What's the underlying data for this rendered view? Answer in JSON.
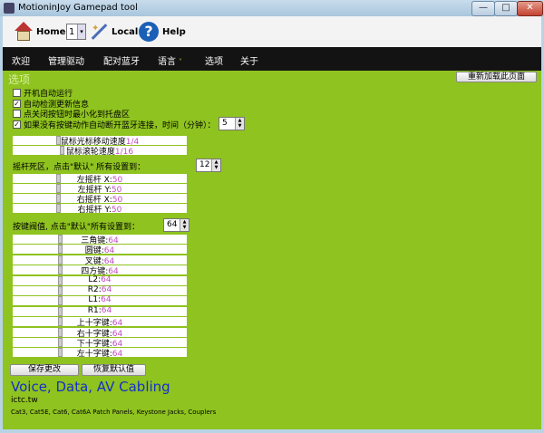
{
  "window": {
    "title": "MotioninJoy Gamepad tool",
    "min": "—",
    "max": "□",
    "close": "✕"
  },
  "toolbar": {
    "home": "Home",
    "selected": "1",
    "local": "Local",
    "help": "Help",
    "help_glyph": "?"
  },
  "menu": [
    "欢迎",
    "管理驱动",
    "配对蓝牙",
    "语言",
    "选项",
    "关于"
  ],
  "menu_chevron": "˅",
  "page": {
    "title": "选项",
    "reload": "重新加载此页面"
  },
  "options": [
    {
      "label": "开机自动运行",
      "checked": false
    },
    {
      "label": "自动检测更新信息",
      "checked": true
    },
    {
      "label": "点关闭按钮时最小化到托盘区",
      "checked": false
    },
    {
      "label": "如果没有按键动作自动断开蓝牙连接，时间（分钟）：",
      "checked": true
    }
  ],
  "timeout": "5",
  "mouse_sliders": [
    {
      "label": "鼠标光标移动速度",
      "value": "1/4",
      "level": 0.25
    },
    {
      "label": "鼠标滚轮速度",
      "value": "1/16",
      "level": 0.27
    }
  ],
  "deadzone": {
    "label": "摇杆死区，点击\"默认\" 所有设置到：",
    "value": "12",
    "sliders": [
      {
        "label": "左摇杆 X:",
        "value": "50"
      },
      {
        "label": "左摇杆 Y:",
        "value": "50"
      },
      {
        "label": "右摇杆 X:",
        "value": "50"
      },
      {
        "label": "右摇杆 Y:",
        "value": "50"
      }
    ]
  },
  "threshold": {
    "label": "按键阀值, 点击\"默认\"所有设置到：",
    "value": "64",
    "sliders": [
      {
        "label": "三角键:",
        "value": "64"
      },
      {
        "label": "圆键:",
        "value": "64"
      },
      {
        "label": "叉键:",
        "value": "64"
      },
      {
        "label": "四方键:",
        "value": "64"
      },
      {
        "label": "L2:",
        "value": "64"
      },
      {
        "label": "R2:",
        "value": "64"
      },
      {
        "label": "L1:",
        "value": "64"
      },
      {
        "label": "R1:",
        "value": "64"
      },
      {
        "label": "上十字键:",
        "value": "64"
      },
      {
        "label": "右十字键:",
        "value": "64"
      },
      {
        "label": "下十字键:",
        "value": "64"
      },
      {
        "label": "左十字键:",
        "value": "64"
      }
    ]
  },
  "buttons": {
    "save": "保存更改",
    "restore": "恢复默认值"
  },
  "ad": {
    "title": "Voice, Data, AV Cabling",
    "url": "ictc.tw",
    "text": "Cat3, Cat5E, Cat6, Cat6A Patch Panels, Keystone Jacks, Couplers"
  },
  "colors": {
    "content_bg": "#8fc31f",
    "menubar_bg": "#131313",
    "value_text": "#c04ac4",
    "ad_title": "#1530c8"
  }
}
